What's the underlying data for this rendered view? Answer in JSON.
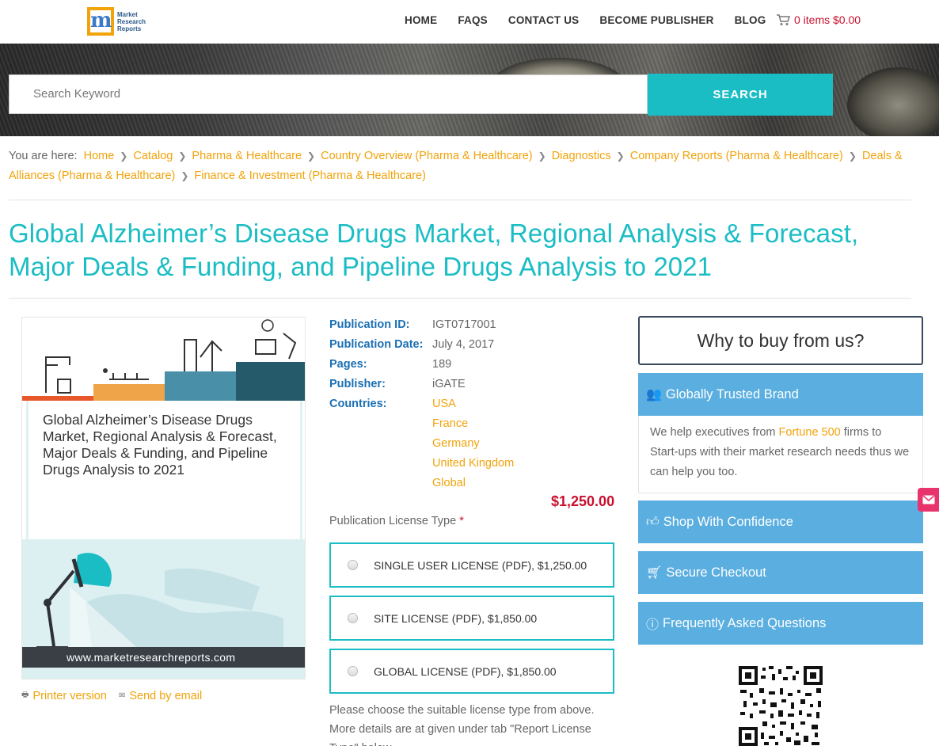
{
  "header": {
    "logo_text": [
      "Market",
      "Research",
      "Reports"
    ],
    "nav": [
      "HOME",
      "FAQS",
      "CONTACT US",
      "BECOME PUBLISHER",
      "BLOG"
    ],
    "cart_text": "0 items $0.00"
  },
  "search": {
    "placeholder": "Search Keyword",
    "button_label": "SEARCH"
  },
  "breadcrumb": {
    "prefix": "You are here:",
    "items": [
      "Home",
      "Catalog",
      "Pharma & Healthcare",
      "Country Overview (Pharma & Healthcare)",
      "Diagnostics",
      "Company Reports (Pharma & Healthcare)",
      "Deals & Alliances (Pharma & Healthcare)",
      "Finance & Investment (Pharma & Healthcare)"
    ]
  },
  "page_title": "Global Alzheimer’s Disease Drugs Market, Regional Analysis & Forecast, Major Deals & Funding, and Pipeline Drugs Analysis to 2021",
  "product_image": {
    "title": "Global Alzheimer’s Disease Drugs Market, Regional Analysis & Forecast, Major Deals & Funding, and Pipeline Drugs Analysis to 2021",
    "url": "www.marketresearchreports.com"
  },
  "tools": {
    "printer": "Printer version",
    "email": "Send by email"
  },
  "details": {
    "publication_id_label": "Publication ID:",
    "publication_id": "IGT0717001",
    "publication_date_label": "Publication Date:",
    "publication_date": "July 4, 2017",
    "pages_label": "Pages:",
    "pages": "189",
    "publisher_label": "Publisher:",
    "publisher": "iGATE",
    "countries_label": "Countries:",
    "countries": [
      "USA",
      "France",
      "Germany",
      "United Kingdom",
      "Global"
    ]
  },
  "price": "$1,250.00",
  "license": {
    "label": "Publication License Type",
    "required_mark": "*",
    "options": [
      "SINGLE USER LICENSE (PDF), $1,250.00",
      "SITE LICENSE (PDF), $1,850.00",
      "GLOBAL LICENSE (PDF), $1,850.00"
    ],
    "note": "Please choose the suitable license type from above. More details are at given under tab \"Report License Type\" below."
  },
  "sidebar": {
    "why_title": "Why to buy from us?",
    "trusted_title": "Globally Trusted Brand",
    "trusted_body_1": "We help executives from ",
    "trusted_link": "Fortune 500",
    "trusted_body_2": " firms to Start-ups with their market research needs thus we can help you too.",
    "shop_title": "Shop With Confidence",
    "secure_title": "Secure Checkout",
    "faq_title": "Frequently Asked Questions"
  },
  "colors": {
    "accent_teal": "#1bbdc4",
    "link_orange": "#f0a30a",
    "label_blue": "#1a6fb4",
    "price_red": "#c8102e",
    "sidebar_blue": "#5aaee0"
  }
}
